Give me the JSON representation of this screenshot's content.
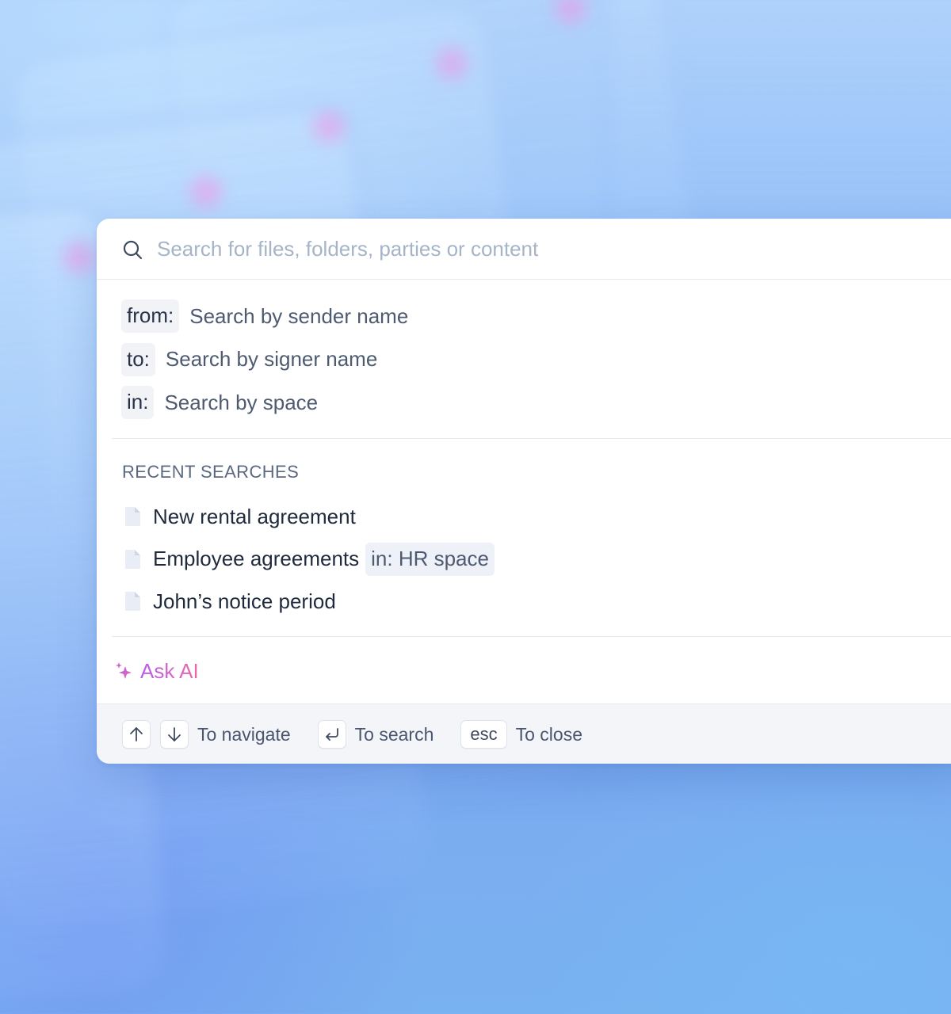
{
  "search": {
    "placeholder": "Search for files, folders, parties or content",
    "value": ""
  },
  "filters": [
    {
      "chip": "from:",
      "text": "Search by sender name"
    },
    {
      "chip": "to:",
      "text": "Search by signer name"
    },
    {
      "chip": "in:",
      "text": "Search by space"
    }
  ],
  "recent": {
    "heading": "RECENT SEARCHES",
    "items": [
      {
        "text": "New rental agreement",
        "chip": ""
      },
      {
        "text": "Employee agreements",
        "chip": "in: HR space"
      },
      {
        "text": "John’s notice period",
        "chip": ""
      }
    ]
  },
  "ask_ai": {
    "label": "Ask AI"
  },
  "footer": {
    "navigate_label": "To navigate",
    "search_label": "To search",
    "esc_key": "esc",
    "close_label": "To close"
  },
  "colors": {
    "accent_gradient_start": "#b65cf0",
    "accent_gradient_end": "#e86aa8",
    "placeholder": "#a6b4c8",
    "chip_bg": "#f1f3f7"
  }
}
